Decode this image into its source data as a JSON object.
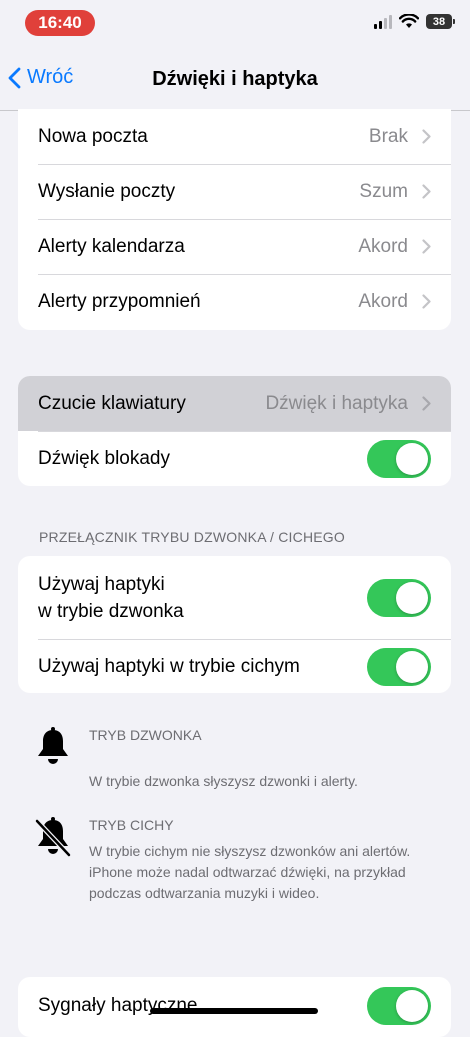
{
  "status": {
    "time": "16:40",
    "battery": "38"
  },
  "nav": {
    "back_label": "Wróć",
    "title": "Dźwięki i haptyka"
  },
  "sounds_group": [
    {
      "label": "Nowa poczta",
      "value": "Brak"
    },
    {
      "label": "Wysłanie poczty",
      "value": "Szum"
    },
    {
      "label": "Alerty kalendarza",
      "value": "Akord"
    },
    {
      "label": "Alerty przypomnień",
      "value": "Akord"
    }
  ],
  "keyboard_group": {
    "keyboard_feel": {
      "label": "Czucie klawiatury",
      "value": "Dźwięk i haptyka"
    },
    "lock_sound": {
      "label": "Dźwięk blokady",
      "on": true
    }
  },
  "ring_silent": {
    "header": "PRZEŁĄCZNIK TRYBU DZWONKA / CICHEGO",
    "haptics_ring": {
      "label": "Używaj haptyki\nw trybie dzwonka",
      "on": true
    },
    "haptics_silent": {
      "label": "Używaj haptyki w trybie cichym",
      "on": true
    }
  },
  "info": {
    "ring_title": "TRYB DZWONKA",
    "ring_desc": "W trybie dzwonka słyszysz dzwonki i alerty.",
    "silent_title": "TRYB CICHY",
    "silent_desc": "W trybie cichym nie słyszysz dzwonków ani alertów. iPhone może nadal odtwarzać dźwięki, na przykład podczas odtwarzania muzyki i wideo."
  },
  "system_haptics": {
    "label": "Sygnały haptyczne",
    "on": true
  },
  "colors": {
    "accent": "#0a7aff",
    "toggle_on": "#34c759",
    "time_pill": "#e0403a"
  }
}
